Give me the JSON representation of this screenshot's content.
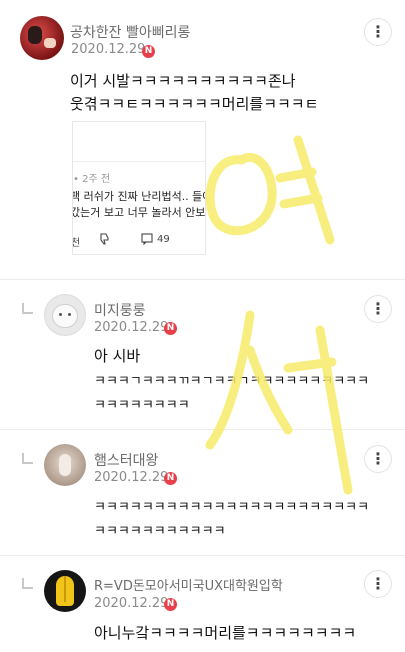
{
  "comments": [
    {
      "nickname": "공차한잔 빨아삐리롱",
      "date": "2020.12.29",
      "new_badge": "N",
      "more_icon": "⋮",
      "text_lines": [
        "이거 시발ㅋㅋㅋㅋㅋㅋㅋㅋㅋㅋ존나",
        "웃겪ㅋㅋㅌㅋㅋㅋㅋㅋㅋ머리를ㅋㅋㅋㅌ"
      ],
      "embed": {
        "time": "• 2주 전",
        "line1": "팩 러쉬가 진짜 난리법석.. 들어갔",
        "line2": "갔는거 보고 너무 놀라서 안보이",
        "action1": "천",
        "comment_count": "49"
      }
    },
    {
      "nickname": "미지룽룽",
      "date": "2020.12.29",
      "new_badge": "N",
      "more_icon": "⋮",
      "text_lines": [
        "아 시바",
        "ㅋㅋㅋㄱㅋㅋㅋㄲㅋㄱㅋㅋㄱㅋㅋㅋㅋㅋㅋㅋㅋㅋㅋ",
        "ㅋㅋㅋㅋㅋㅋㅋㅋ"
      ]
    },
    {
      "nickname": "햄스터대왕",
      "date": "2020.12.29",
      "new_badge": "N",
      "more_icon": "⋮",
      "text_lines": [
        "ㅋㅋㅋㅋㅋㅋㅋㅋㅋㅋㅋㅋㅋㅋㅋㅋㅋㅋㅋㅋㅋㅋㅋ",
        "ㅋㅋㅋㅋㅋㅋㅋㅋㅋㅋㅋ"
      ]
    },
    {
      "nickname": "R=VD돈모아서미국UX대학원입학",
      "date": "2020.12.29",
      "new_badge": "N",
      "more_icon": "⋮",
      "text_lines": [
        "아니누갘ㅋㅋㅋㅋ머리를ㅋㅋㅋㅋㅋㅋㅋㅋ"
      ]
    }
  ],
  "watermark": {
    "char1": "여",
    "char2": "서",
    "color": "#f7ec6a"
  }
}
